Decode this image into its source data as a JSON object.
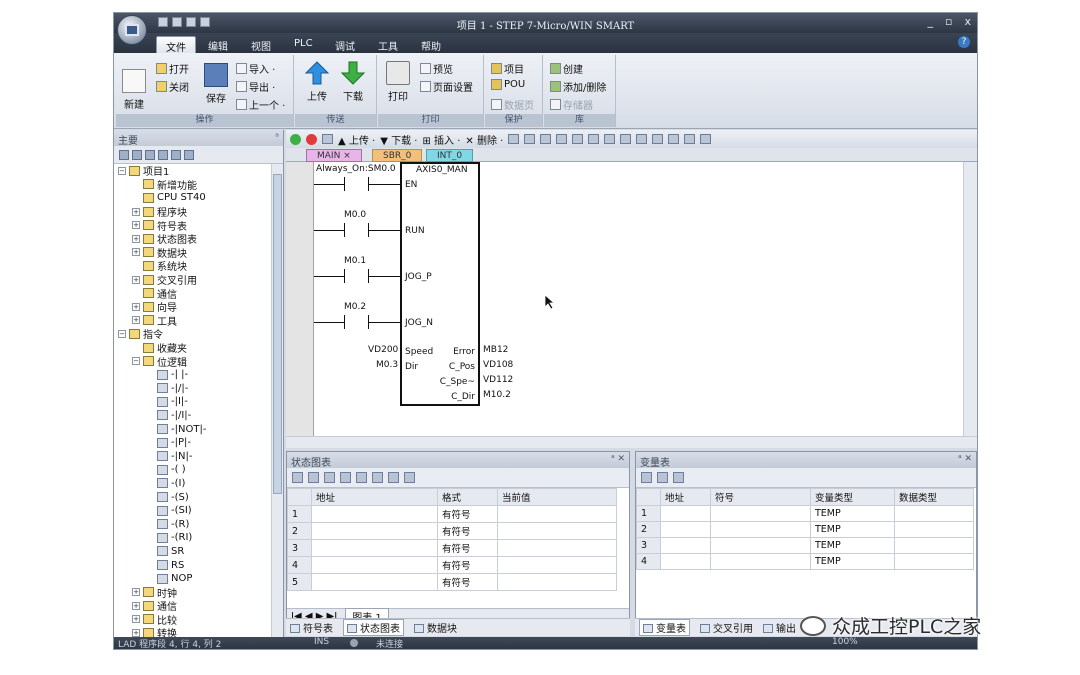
{
  "window": {
    "title": "项目 1 - STEP 7-Micro/WIN SMART",
    "min": "_",
    "max": "▫",
    "close": "x"
  },
  "menu": {
    "tabs": [
      "文件",
      "编辑",
      "视图",
      "PLC",
      "调试",
      "工具",
      "帮助"
    ],
    "active": "文件",
    "help": "?"
  },
  "ribbon": {
    "groups": {
      "operation": "操作",
      "transfer": "传送",
      "print": "打印",
      "protect": "保护",
      "library": "库"
    },
    "new": "新建",
    "open": "打开",
    "close": "关闭",
    "save": "保存",
    "import": "导入 ·",
    "export": "导出 ·",
    "previous": "上一个 ·",
    "upload": "上传",
    "download": "下载",
    "print": "打印",
    "preview": "预览",
    "page_setup": "页面设置",
    "project": "项目",
    "pou": "POU",
    "data_page": "数据页",
    "create": "创建",
    "add_remove": "添加/删除",
    "memory": "存储器"
  },
  "sidebar": {
    "title": "主要",
    "pin": "ᵃ",
    "tree": [
      {
        "label": "项目1",
        "level": 0,
        "expander": "−"
      },
      {
        "label": "新增功能",
        "level": 1
      },
      {
        "label": "CPU ST40",
        "level": 1
      },
      {
        "label": "程序块",
        "level": 1,
        "expander": "+"
      },
      {
        "label": "符号表",
        "level": 1,
        "expander": "+"
      },
      {
        "label": "状态图表",
        "level": 1,
        "expander": "+"
      },
      {
        "label": "数据块",
        "level": 1,
        "expander": "+"
      },
      {
        "label": "系统块",
        "level": 1
      },
      {
        "label": "交叉引用",
        "level": 1,
        "expander": "+"
      },
      {
        "label": "通信",
        "level": 1
      },
      {
        "label": "向导",
        "level": 1,
        "expander": "+"
      },
      {
        "label": "工具",
        "level": 1,
        "expander": "+"
      },
      {
        "label": "指令",
        "level": 0,
        "expander": "−"
      },
      {
        "label": "收藏夹",
        "level": 1
      },
      {
        "label": "位逻辑",
        "level": 1,
        "expander": "−"
      },
      {
        "label": "-| |-",
        "level": 2,
        "kind": "contact"
      },
      {
        "label": "-|/|-",
        "level": 2,
        "kind": "contact"
      },
      {
        "label": "-|I|-",
        "level": 2,
        "kind": "contact"
      },
      {
        "label": "-|/I|-",
        "level": 2,
        "kind": "contact"
      },
      {
        "label": "-|NOT|-",
        "level": 2,
        "kind": "contact"
      },
      {
        "label": "-|P|-",
        "level": 2,
        "kind": "contact"
      },
      {
        "label": "-|N|-",
        "level": 2,
        "kind": "contact"
      },
      {
        "label": "-( )",
        "level": 2,
        "kind": "coil"
      },
      {
        "label": "-(I)",
        "level": 2,
        "kind": "coil"
      },
      {
        "label": "-(S)",
        "level": 2,
        "kind": "coil"
      },
      {
        "label": "-(SI)",
        "level": 2,
        "kind": "coil"
      },
      {
        "label": "-(R)",
        "level": 2,
        "kind": "coil"
      },
      {
        "label": "-(RI)",
        "level": 2,
        "kind": "coil"
      },
      {
        "label": "SR",
        "level": 2,
        "kind": "box"
      },
      {
        "label": "RS",
        "level": 2,
        "kind": "box"
      },
      {
        "label": "NOP",
        "level": 2,
        "kind": "box"
      },
      {
        "label": "时钟",
        "level": 1,
        "expander": "+"
      },
      {
        "label": "通信",
        "level": 1,
        "expander": "+"
      },
      {
        "label": "比较",
        "level": 1,
        "expander": "+"
      },
      {
        "label": "转换",
        "level": 1,
        "expander": "+"
      }
    ]
  },
  "editor": {
    "toolbar": {
      "upload": "上传 ·",
      "download": "下载 ·",
      "insert": "插入 ·",
      "delete": "删除 ·"
    },
    "tabs": [
      {
        "label": "MAIN",
        "close": "×"
      },
      {
        "label": "SBR_0"
      },
      {
        "label": "INT_0"
      }
    ],
    "ladder": {
      "always_on": "Always_On:SM0.0",
      "m00": "M0.0",
      "m01": "M0.1",
      "m02": "M0.2",
      "block_title": "AXIS0_MAN",
      "en": "EN",
      "run": "RUN",
      "jog_p": "JOG_P",
      "jog_n": "JOG_N",
      "speed_in": "VD200",
      "speed": "Speed",
      "dir_in": "M0.3",
      "dir": "Dir",
      "error": "Error",
      "error_out": "MB12",
      "cpos": "C_Pos",
      "cpos_out": "VD108",
      "cspe": "C_Spe~",
      "cspe_out": "VD112",
      "cdir": "C_Dir",
      "cdir_out": "M10.2"
    }
  },
  "status_chart": {
    "title": "状态图表",
    "close": "ᵃ ✕",
    "columns": [
      "",
      "地址",
      "格式",
      "当前值"
    ],
    "rows": [
      {
        "n": "1",
        "addr": "",
        "fmt": "有符号",
        "val": ""
      },
      {
        "n": "2",
        "addr": "",
        "fmt": "有符号",
        "val": ""
      },
      {
        "n": "3",
        "addr": "",
        "fmt": "有符号",
        "val": ""
      },
      {
        "n": "4",
        "addr": "",
        "fmt": "有符号",
        "val": ""
      },
      {
        "n": "5",
        "addr": "",
        "fmt": "有符号",
        "val": ""
      }
    ],
    "sheet_nav": "I◀ ◀ ▶ ▶I",
    "sheet": "图表 1"
  },
  "var_table": {
    "title": "变量表",
    "close": "ᵃ ✕",
    "columns": [
      "",
      "地址",
      "符号",
      "变量类型",
      "数据类型"
    ],
    "rows": [
      {
        "n": "1",
        "addr": "",
        "sym": "",
        "vtype": "TEMP",
        "dtype": ""
      },
      {
        "n": "2",
        "addr": "",
        "sym": "",
        "vtype": "TEMP",
        "dtype": ""
      },
      {
        "n": "3",
        "addr": "",
        "sym": "",
        "vtype": "TEMP",
        "dtype": ""
      },
      {
        "n": "4",
        "addr": "",
        "sym": "",
        "vtype": "TEMP",
        "dtype": ""
      }
    ]
  },
  "bottom_tabs_left": [
    "符号表",
    "状态图表",
    "数据块"
  ],
  "bottom_tabs_right": [
    "变量表",
    "交叉引用",
    "输出"
  ],
  "statusbar": {
    "position": "LAD 程序段 4, 行 4, 列 2",
    "ins": "INS",
    "conn": "未连接",
    "zoom": "100%"
  },
  "watermark": "众成工控PLC之家"
}
